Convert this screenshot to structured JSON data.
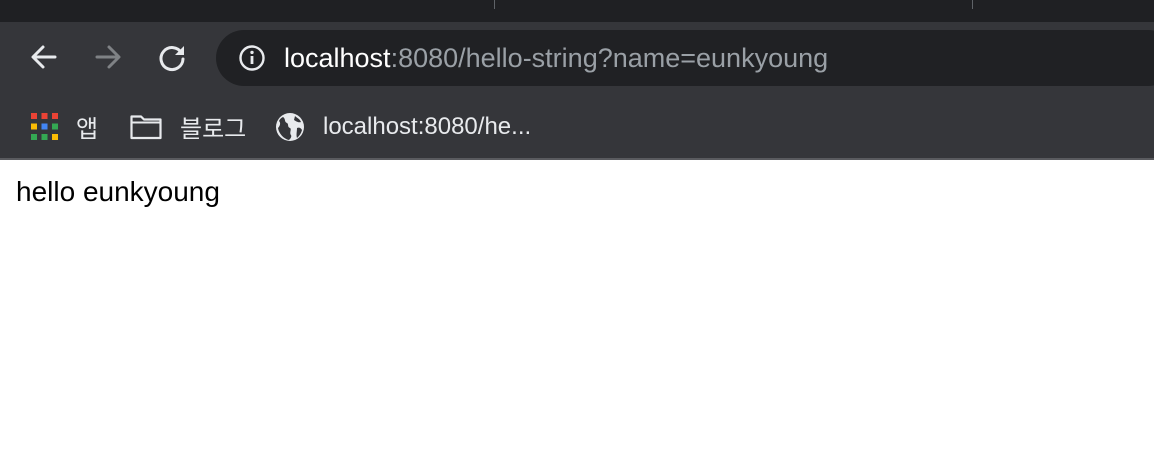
{
  "browser": {
    "address_bar": {
      "host": "localhost",
      "path": ":8080/hello-string?name=eunkyoung"
    },
    "bookmarks": [
      {
        "label": "앱",
        "icon": "apps-grid-icon"
      },
      {
        "label": "블로그",
        "icon": "folder-icon"
      },
      {
        "label": "localhost:8080/he...",
        "icon": "globe-icon"
      }
    ]
  },
  "page": {
    "body_text": "hello eunkyoung"
  },
  "colors": {
    "toolbar_bg": "#35363a",
    "omnibox_bg": "#202124",
    "tabstrip_bg": "#1f2023",
    "page_bg": "#ffffff"
  }
}
